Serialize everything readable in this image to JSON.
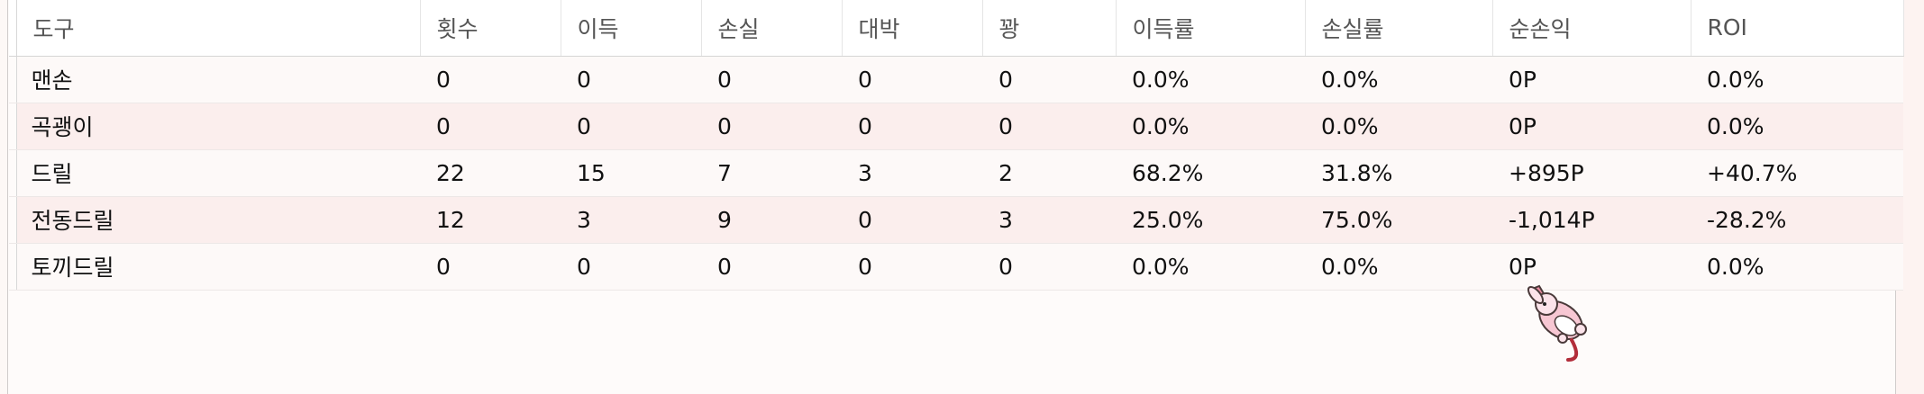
{
  "table": {
    "columns": [
      "도구",
      "횟수",
      "이득",
      "손실",
      "대박",
      "꽝",
      "이득률",
      "손실률",
      "순손익",
      "ROI"
    ],
    "rows": [
      [
        "맨손",
        "0",
        "0",
        "0",
        "0",
        "0",
        "0.0%",
        "0.0%",
        "0P",
        "0.0%"
      ],
      [
        "곡괭이",
        "0",
        "0",
        "0",
        "0",
        "0",
        "0.0%",
        "0.0%",
        "0P",
        "0.0%"
      ],
      [
        "드릴",
        "22",
        "15",
        "7",
        "3",
        "2",
        "68.2%",
        "31.8%",
        "+895P",
        "+40.7%"
      ],
      [
        "전동드릴",
        "12",
        "3",
        "9",
        "0",
        "3",
        "25.0%",
        "75.0%",
        "-1,014P",
        "-28.2%"
      ],
      [
        "토끼드릴",
        "0",
        "0",
        "0",
        "0",
        "0",
        "0.0%",
        "0.0%",
        "0P",
        "0.0%"
      ]
    ]
  },
  "cursor": {
    "icon": "rabbit-cursor-icon"
  },
  "colors": {
    "row_odd": "#fdf9f8",
    "row_even": "#fbeeed",
    "header_text": "#555555",
    "cell_text": "#111111"
  }
}
